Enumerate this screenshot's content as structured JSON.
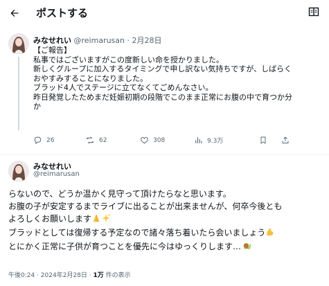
{
  "header": {
    "title": "ポストする"
  },
  "tweet1": {
    "display_name": "みなせれい",
    "handle_date": "@reimarusan · 2月28日",
    "lines": [
      "【ご報告】",
      "私事ではございますがこの度新しい命を授かりました。",
      "新しくグループに加入するタイミングで申し訳ない気持ちですが、しばらく",
      "おやすみすることになりました。",
      "ブラッド4人でステージに立てなくてごめんなさい。",
      "昨日発覚したためまだ妊娠初期の段階でこのまま正常にお腹の中で育つか分",
      "か"
    ],
    "actions": {
      "replies": "26",
      "reposts": "62",
      "likes": "308",
      "views": "9.3万"
    }
  },
  "tweet2": {
    "display_name": "みなせれい",
    "handle": "@reimarusan",
    "lines": [
      "らないので、どうか温かく見守って頂けたらなと思います。",
      "お腹の子が安定するまでライブに出ることが出来ませんが、何卒今後とも",
      "よろしくお願いします",
      "ブラッドとしては復帰する予定なので諸々落ち着いたら会いましょう",
      "とにかく正常に子供が育つことを優先に今はゆっくりします…"
    ],
    "meta_time": "午後0:24 · 2024年2月28日 · ",
    "meta_views": "1万",
    "meta_views_suffix": " 件の表示"
  },
  "icons": {
    "back": "arrow-left-icon",
    "reader": "reader-mode-icon",
    "reply": "reply-icon",
    "repost": "repost-icon",
    "like": "heart-icon",
    "views": "views-chart-icon",
    "bookmark": "bookmark-icon",
    "share": "share-icon",
    "emoji_pray": "folded-hands-emoji",
    "emoji_sparkle": "sparkles-emoji",
    "emoji_muscle": "flexed-biceps-emoji",
    "emoji_snail": "snail-emoji"
  },
  "colors": {
    "text": "#0f1419",
    "secondary": "#536471",
    "divider": "#eff3f4"
  }
}
